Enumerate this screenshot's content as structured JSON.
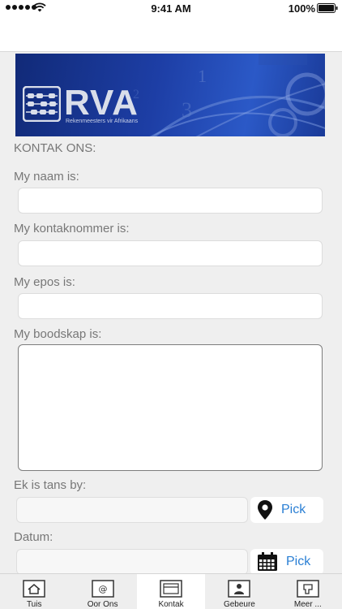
{
  "status_bar": {
    "time": "9:41 AM",
    "battery": "100%"
  },
  "banner": {
    "title": "RVA",
    "subtitle": "Rekenmeesters vir Afrikaans"
  },
  "form": {
    "title": "KONTAK ONS:",
    "name_label": "My naam is:",
    "name_value": "",
    "phone_label": "My kontaknommer is:",
    "phone_value": "",
    "email_label": "My epos is:",
    "email_value": "",
    "message_label": "My boodskap is:",
    "message_value": "",
    "location_label": "Ek is tans by:",
    "location_value": "",
    "location_pick": "Pick",
    "date_label": "Datum:",
    "date_value": "",
    "date_pick": "Pick"
  },
  "tabs": [
    {
      "label": "Tuis",
      "icon": "home-icon"
    },
    {
      "label": "Oor Ons",
      "icon": "at-sign-icon"
    },
    {
      "label": "Kontak",
      "icon": "contact-card-icon",
      "active": true
    },
    {
      "label": "Gebeure",
      "icon": "person-badge-icon"
    },
    {
      "label": "Meer ...",
      "icon": "more-icon"
    }
  ],
  "colors": {
    "accent": "#2a7fd4",
    "banner": "#1d3ea5",
    "background": "#efefef"
  }
}
